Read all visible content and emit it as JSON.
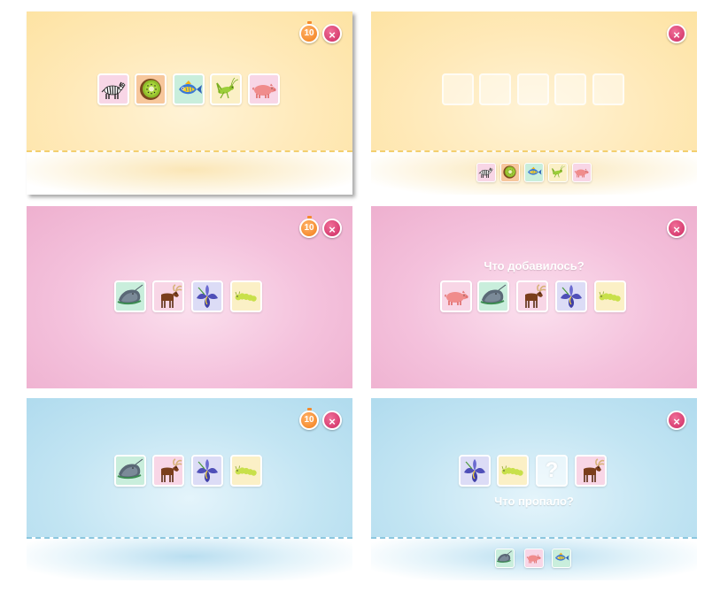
{
  "screens": [
    {
      "id": "p1",
      "theme": "yellow",
      "timer": "10",
      "close": "×",
      "items": [
        "zebra",
        "kiwi",
        "fish",
        "grasshopper",
        "pig"
      ]
    },
    {
      "id": "p2",
      "theme": "yellow",
      "close": "×",
      "blank_slots": 5,
      "tray_items": [
        "zebra",
        "kiwi",
        "fish",
        "grasshopper",
        "pig"
      ]
    },
    {
      "id": "p3",
      "theme": "pink",
      "timer": "10",
      "close": "×",
      "items": [
        "stingray",
        "moose",
        "iris",
        "caterpillar"
      ]
    },
    {
      "id": "p4",
      "theme": "pink",
      "close": "×",
      "question": "Что добавилось?",
      "items": [
        "pig",
        "stingray",
        "moose",
        "iris",
        "caterpillar"
      ]
    },
    {
      "id": "p5",
      "theme": "blue",
      "timer": "10",
      "close": "×",
      "items": [
        "stingray",
        "moose",
        "iris",
        "caterpillar"
      ]
    },
    {
      "id": "p6",
      "theme": "blue",
      "close": "×",
      "question": "Что пропало?",
      "question_mark": "?",
      "items": [
        "iris",
        "caterpillar",
        "missing",
        "moose"
      ],
      "tray_items": [
        "stingray",
        "pig",
        "fish"
      ]
    }
  ],
  "colors": {
    "close_button": "#d83f72",
    "timer_button": "#f58a2c",
    "yellow_bg": "#ffe9b8",
    "pink_bg": "#f4c1dc",
    "blue_bg": "#c3e5f3"
  }
}
